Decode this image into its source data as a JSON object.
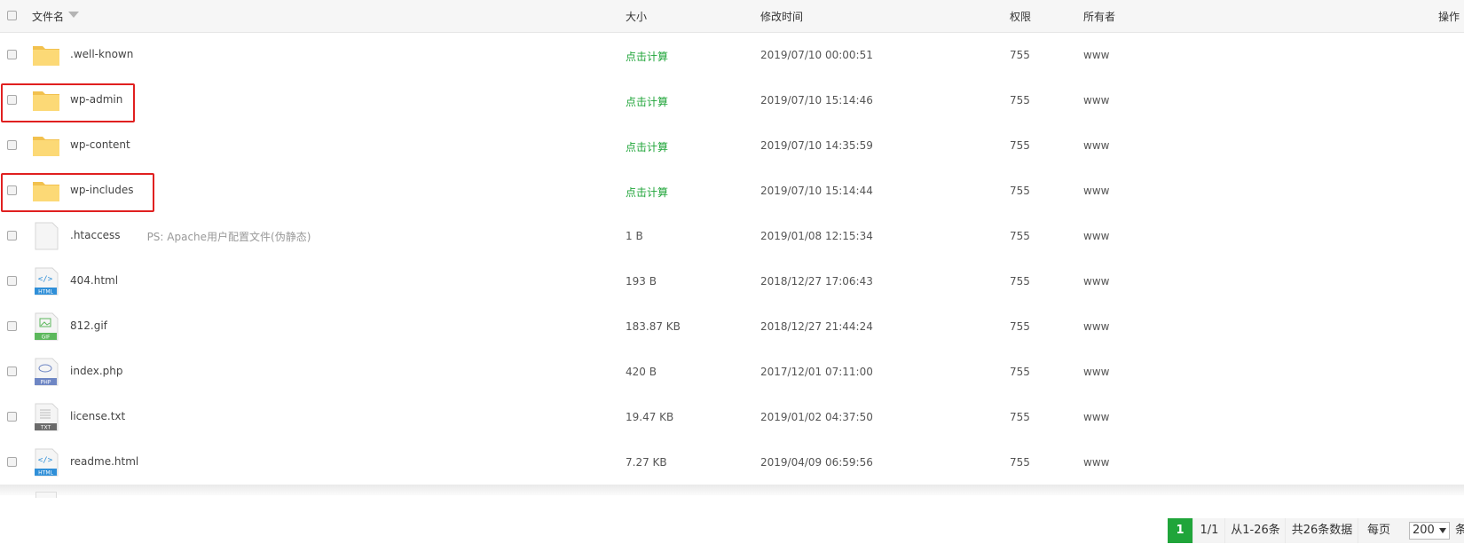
{
  "header": {
    "name": "文件名",
    "size": "大小",
    "mtime": "修改时间",
    "perm": "权限",
    "owner": "所有者",
    "ops": "操作"
  },
  "rows": [
    {
      "name": ".well-known",
      "note": "",
      "size": "点击计算",
      "time": "2019/07/10 00:00:51",
      "perm": "755",
      "owner": "www",
      "icon": "folder-icon"
    },
    {
      "name": "wp-admin",
      "note": "",
      "size": "点击计算",
      "time": "2019/07/10 15:14:46",
      "perm": "755",
      "owner": "www",
      "icon": "folder-icon"
    },
    {
      "name": "wp-content",
      "note": "",
      "size": "点击计算",
      "time": "2019/07/10 14:35:59",
      "perm": "755",
      "owner": "www",
      "icon": "folder-icon"
    },
    {
      "name": "wp-includes",
      "note": "",
      "size": "点击计算",
      "time": "2019/07/10 15:14:44",
      "perm": "755",
      "owner": "www",
      "icon": "folder-icon"
    },
    {
      "name": ".htaccess",
      "note": "PS: Apache用户配置文件(伪静态)",
      "size": "1 B",
      "time": "2019/01/08 12:15:34",
      "perm": "755",
      "owner": "www",
      "icon": "blank-file-icon"
    },
    {
      "name": "404.html",
      "note": "",
      "size": "193 B",
      "time": "2018/12/27 17:06:43",
      "perm": "755",
      "owner": "www",
      "icon": "html-file-icon",
      "badge": "HTML"
    },
    {
      "name": "812.gif",
      "note": "",
      "size": "183.87 KB",
      "time": "2018/12/27 21:44:24",
      "perm": "755",
      "owner": "www",
      "icon": "gif-file-icon",
      "badge": "GIF"
    },
    {
      "name": "index.php",
      "note": "",
      "size": "420 B",
      "time": "2017/12/01 07:11:00",
      "perm": "755",
      "owner": "www",
      "icon": "php-file-icon",
      "badge": "PHP"
    },
    {
      "name": "license.txt",
      "note": "",
      "size": "19.47 KB",
      "time": "2019/01/02 04:37:50",
      "perm": "755",
      "owner": "www",
      "icon": "txt-file-icon",
      "badge": "TXT"
    },
    {
      "name": "readme.html",
      "note": "",
      "size": "7.27 KB",
      "time": "2019/04/09 06:59:56",
      "perm": "755",
      "owner": "www",
      "icon": "html-file-icon",
      "badge": "HTML"
    }
  ],
  "pagination": {
    "current": "1",
    "pages": "1/1",
    "range": "从1-26条",
    "total": "共26条数据",
    "per_page_label": "每页",
    "per_page_value": "200",
    "unit": "条"
  },
  "colors": {
    "accent": "#20a53a",
    "highlight": "#e02020",
    "folder": "#fbd96f"
  }
}
